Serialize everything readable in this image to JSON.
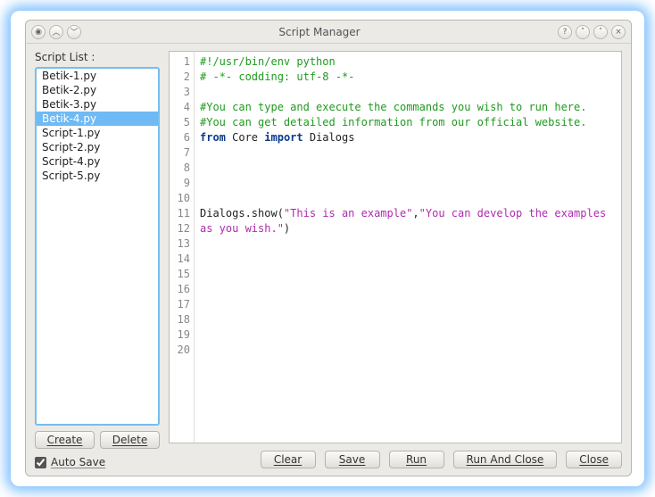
{
  "window": {
    "title": "Script Manager"
  },
  "sidebar": {
    "label": "Script List :",
    "items": [
      {
        "name": "Betik-1.py",
        "selected": false
      },
      {
        "name": "Betik-2.py",
        "selected": false
      },
      {
        "name": "Betik-3.py",
        "selected": false
      },
      {
        "name": "Betik-4.py",
        "selected": true
      },
      {
        "name": "Script-1.py",
        "selected": false
      },
      {
        "name": "Script-2.py",
        "selected": false
      },
      {
        "name": "Script-4.py",
        "selected": false
      },
      {
        "name": "Script-5.py",
        "selected": false
      }
    ],
    "create_label": "Create",
    "delete_label": "Delete",
    "autosave_label": "Auto Save",
    "autosave_checked": true
  },
  "editor": {
    "line_count": 20,
    "lines": [
      {
        "n": 1,
        "t": "#!/usr/bin/env python",
        "cls": "c-comment"
      },
      {
        "n": 2,
        "t": "# -*- codding: utf-8 -*-",
        "cls": "c-comment"
      },
      {
        "n": 3,
        "t": "",
        "cls": ""
      },
      {
        "n": 4,
        "t": "#You can type and execute the commands you wish to run here.",
        "cls": "c-comment"
      },
      {
        "n": 5,
        "t": "#You can get detailed information from our official website.",
        "cls": "c-comment"
      },
      {
        "n": 6,
        "html": "<span class=\"c-kw\">from</span> Core <span class=\"c-kw\">import</span> Dialogs"
      },
      {
        "n": 7,
        "t": "",
        "cls": ""
      },
      {
        "n": 8,
        "t": "",
        "cls": ""
      },
      {
        "n": 9,
        "t": "",
        "cls": ""
      },
      {
        "n": 10,
        "t": "",
        "cls": ""
      },
      {
        "n": 11,
        "html": "Dialogs.show(<span class=\"c-str\">\"This is an example\"</span>,<span class=\"c-str\">\"You can develop the examples as you wish.\"</span>)"
      },
      {
        "n": 12,
        "t": "",
        "cls": ""
      },
      {
        "n": 13,
        "t": "",
        "cls": ""
      },
      {
        "n": 14,
        "t": "",
        "cls": ""
      },
      {
        "n": 15,
        "t": "",
        "cls": ""
      },
      {
        "n": 16,
        "t": "",
        "cls": ""
      },
      {
        "n": 17,
        "t": "",
        "cls": ""
      },
      {
        "n": 18,
        "t": "",
        "cls": ""
      },
      {
        "n": 19,
        "t": "",
        "cls": ""
      },
      {
        "n": 20,
        "t": "",
        "cls": ""
      }
    ]
  },
  "footer": {
    "clear_label": "Clear",
    "save_label": "Save",
    "run_label": "Run",
    "run_close_label": "Run And Close",
    "close_label": "Close"
  }
}
